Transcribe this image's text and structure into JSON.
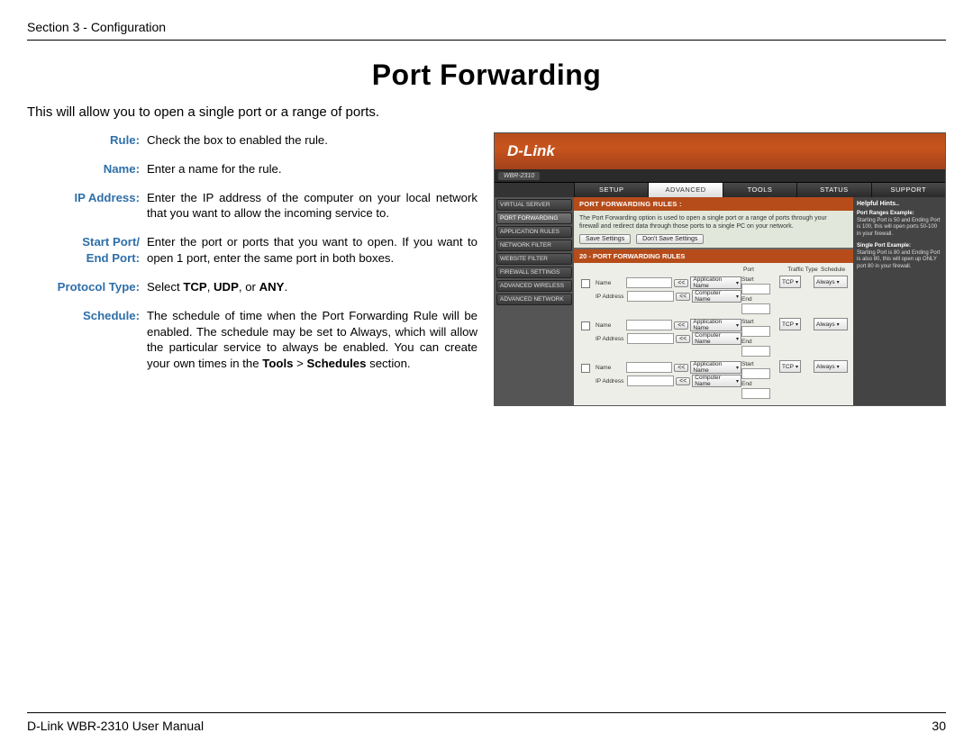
{
  "header": {
    "section": "Section 3 - Configuration"
  },
  "title": "Port Forwarding",
  "intro": "This will allow you to open a single port or a range of ports.",
  "defs": {
    "rule": {
      "label": "Rule:",
      "text": "Check the box to enabled the rule."
    },
    "name": {
      "label": "Name:",
      "text": "Enter a name for the rule."
    },
    "ip": {
      "label": "IP Address:",
      "text": "Enter the IP address of the computer on your local network that you want to allow the incoming service to."
    },
    "port": {
      "label1": "Start Port/",
      "label2": "End Port:",
      "text": "Enter the port or ports that you want to open. If you want to open 1 port, enter the same port in both boxes."
    },
    "proto": {
      "label": "Protocol Type:",
      "text_pre": "Select ",
      "b1": "TCP",
      "mid1": ", ",
      "b2": "UDP",
      "mid2": ", or ",
      "b3": "ANY",
      "post": "."
    },
    "sched": {
      "label": "Schedule:",
      "text_pre": "The schedule of time when the Port Forwarding Rule will be enabled. The schedule may be set to Always, which will allow the particular service to always be enabled. You can create your own times in the ",
      "b1": "Tools",
      "mid": " > ",
      "b2": "Schedules",
      "post": " section."
    }
  },
  "router": {
    "brand": "D-Link",
    "model": "WBR-2310",
    "nav": [
      "SETUP",
      "ADVANCED",
      "TOOLS",
      "STATUS",
      "SUPPORT"
    ],
    "sidebar": [
      "VIRTUAL SERVER",
      "PORT FORWARDING",
      "APPLICATION RULES",
      "NETWORK FILTER",
      "WEBSITE FILTER",
      "FIREWALL SETTINGS",
      "ADVANCED WIRELESS",
      "ADVANCED NETWORK"
    ],
    "panel_title": "PORT FORWARDING RULES :",
    "panel_desc": "The Port Forwarding option is used to open a single port or a range of ports through your firewall and redirect data through those ports to a single PC on your network.",
    "btn_save": "Save Settings",
    "btn_nosave": "Don't Save Settings",
    "rules_title": "20 - PORT FORWARDING RULES",
    "th": {
      "port": "Port",
      "type": "Traffic Type",
      "sched": "Schedule"
    },
    "row": {
      "name_label": "Name",
      "ip_label": "IP Address",
      "btn": "<<",
      "sel_app": "Application Name",
      "sel_comp": "Computer Name",
      "start": "Start",
      "end": "End",
      "tcp": "TCP",
      "always": "Always"
    },
    "help": {
      "title": "Helpful Hints..",
      "h1": "Port Ranges Example:",
      "t1": "Starting Port is 50 and Ending Port is 100, this will open ports 50-100 in your firewall.",
      "h2": "Single Port Example:",
      "t2": "Starting Port is 80 and Ending Port is also 80, this will open up ONLY port 80 in your firewall."
    }
  },
  "footer": {
    "left": "D-Link WBR-2310 User Manual",
    "right": "30"
  }
}
